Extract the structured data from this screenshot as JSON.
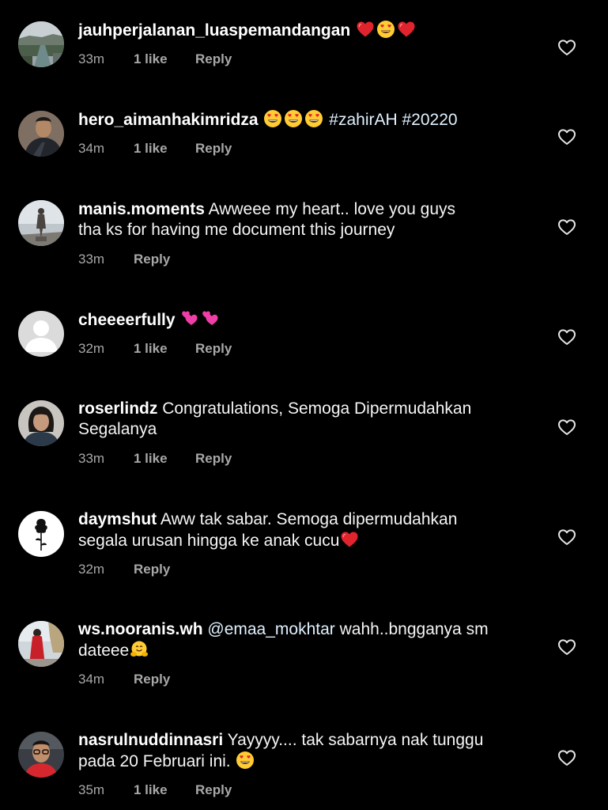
{
  "comments": [
    {
      "username": "jauhperjalanan_luaspemandangan",
      "text_lines": [
        "",
        ""
      ],
      "emojis": [
        "red-heart",
        "heart-eyes",
        "red-heart"
      ],
      "time": "33m",
      "likes": "1 like",
      "reply": "Reply"
    },
    {
      "username": "hero_aimanhakimridza",
      "emojis": [
        "heart-eyes",
        "heart-eyes",
        "heart-eyes"
      ],
      "hashtags": "#zahirAH #20220",
      "time": "34m",
      "likes": "1 like",
      "reply": "Reply"
    },
    {
      "username": "manis.moments",
      "text_line1": "Awweee my heart.. love you guys",
      "text_line2": "tha ks for having me document this journey",
      "time": "33m",
      "reply": "Reply"
    },
    {
      "username": "cheeeerfully",
      "emojis": [
        "two-hearts",
        "two-hearts"
      ],
      "time": "32m",
      "likes": "1 like",
      "reply": "Reply"
    },
    {
      "username": "roserlindz",
      "text_line1": "Congratulations, Semoga Dipermudahkan",
      "text_line2": "Segalanya",
      "time": "33m",
      "likes": "1 like",
      "reply": "Reply"
    },
    {
      "username": "daymshut",
      "text_line1": "Aww tak sabar. Semoga dipermudahkan",
      "text_line2": "segala urusan hingga ke anak cucu",
      "emojis": [
        "red-heart"
      ],
      "time": "32m",
      "reply": "Reply"
    },
    {
      "username": "ws.nooranis.wh",
      "mention": "@emaa_mokhtar",
      "text_line1": "wahh..bngganya sm",
      "text_line2": "dateee",
      "emojis": [
        "hugging-face"
      ],
      "time": "34m",
      "reply": "Reply"
    },
    {
      "username": "nasrulnuddinnasri",
      "text_line1": "Yayyyy.... tak sabarnya nak tunggu",
      "text_line2": "pada 20 Februari ini.",
      "emojis": [
        "heart-eyes"
      ],
      "time": "35m",
      "likes": "1 like",
      "reply": "Reply"
    }
  ],
  "icons": {
    "like": "heart-outline-icon"
  },
  "colors": {
    "background": "#000000",
    "text": "#f5f5f5",
    "meta": "#a8a8a8",
    "link": "#e0f1ff"
  }
}
